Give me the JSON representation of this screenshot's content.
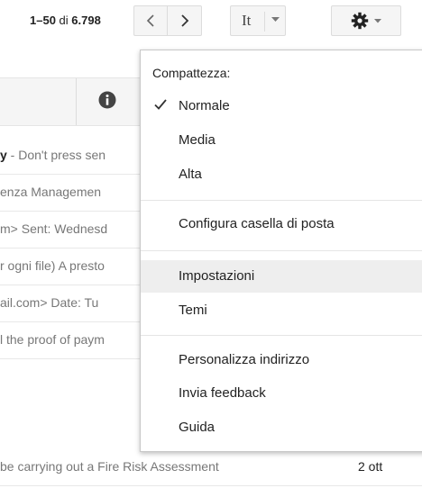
{
  "toolbar": {
    "pager_range": "1–50",
    "pager_of": "di",
    "pager_total": "6.798",
    "prev_icon": "chevron-left-icon",
    "next_icon": "chevron-right-icon",
    "lang_label": "It",
    "settings_icon": "gear-icon"
  },
  "header": {
    "info_icon": "info-icon"
  },
  "mail_rows": [
    {
      "lead": "y",
      "snippet": " - Don't press sen",
      "date": ""
    },
    {
      "lead": "",
      "snippet": "enza Managemen",
      "date": ""
    },
    {
      "lead": "",
      "snippet": "m> Sent: Wednesd",
      "date": ""
    },
    {
      "lead": "",
      "snippet": "r ogni file) A presto",
      "date": ""
    },
    {
      "lead": "",
      "snippet": "ail.com> Date: Tu",
      "date": ""
    },
    {
      "lead": "",
      "snippet": "l the proof of paym",
      "date": ""
    },
    {
      "lead": "",
      "snippet": "be carrying out a Fire Risk Assessment",
      "date": "2 ott"
    }
  ],
  "menu": {
    "heading": "Compattezza:",
    "density": [
      {
        "label": "Normale",
        "checked": true
      },
      {
        "label": "Media",
        "checked": false
      },
      {
        "label": "Alta",
        "checked": false
      }
    ],
    "configure": "Configura casella di posta",
    "settings": "Impostazioni",
    "themes": "Temi",
    "customize_address": "Personalizza indirizzo",
    "feedback": "Invia feedback",
    "help": "Guida",
    "highlight_color": "#eeeeee"
  }
}
